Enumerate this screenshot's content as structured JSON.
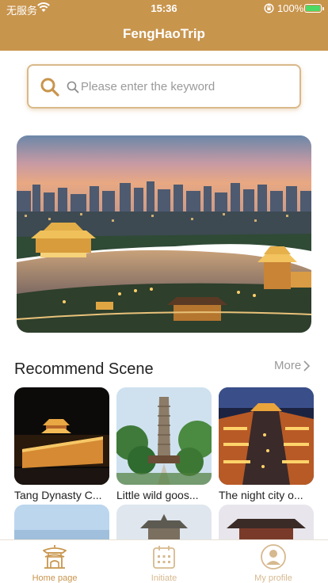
{
  "status_bar": {
    "carrier": "无服务",
    "time": "15:36",
    "battery_percent": "100%"
  },
  "nav": {
    "title": "FengHaoTrip"
  },
  "search": {
    "placeholder": "Please enter the keyword",
    "value": ""
  },
  "section": {
    "title": "Recommend Scene",
    "more_label": "More"
  },
  "scenes": [
    {
      "caption": "Tang Dynasty C..."
    },
    {
      "caption": "Little wild goos..."
    },
    {
      "caption": "The night city o..."
    }
  ],
  "tabs": [
    {
      "label": "Home page",
      "icon": "pavilion-icon",
      "active": true
    },
    {
      "label": "Initiate",
      "icon": "calendar-icon",
      "active": false
    },
    {
      "label": "My profile",
      "icon": "person-icon",
      "active": false
    }
  ],
  "colors": {
    "brand": "#c8954d",
    "brand_light": "#d6b98f"
  }
}
